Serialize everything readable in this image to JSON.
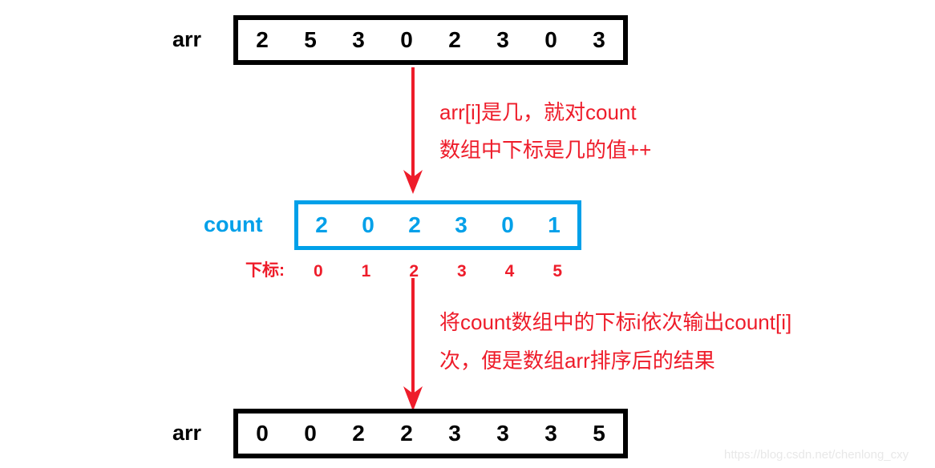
{
  "diagram": {
    "title": "counting-sort-illustration",
    "colors": {
      "red": "#ee1c2a",
      "blue": "#00a0e9",
      "black": "#000000",
      "watermark": "#e8e8e8"
    }
  },
  "input_array": {
    "label": "arr",
    "values": [
      "2",
      "5",
      "3",
      "0",
      "2",
      "3",
      "0",
      "3"
    ]
  },
  "count_array": {
    "label": "count",
    "values": [
      "2",
      "0",
      "2",
      "3",
      "0",
      "1"
    ],
    "index_label": "下标:",
    "indices": [
      "0",
      "1",
      "2",
      "3",
      "4",
      "5"
    ]
  },
  "output_array": {
    "label": "arr",
    "values": [
      "0",
      "0",
      "2",
      "2",
      "3",
      "3",
      "3",
      "5"
    ]
  },
  "annotations": {
    "step1": {
      "line1": "arr[i]是几，就对count",
      "line2": "数组中下标是几的值++"
    },
    "step2": {
      "line1": "将count数组中的下标i依次输出count[i]",
      "line2": "次，便是数组arr排序后的结果"
    }
  },
  "watermark": {
    "text": "https://blog.csdn.net/chenlong_cxy"
  }
}
